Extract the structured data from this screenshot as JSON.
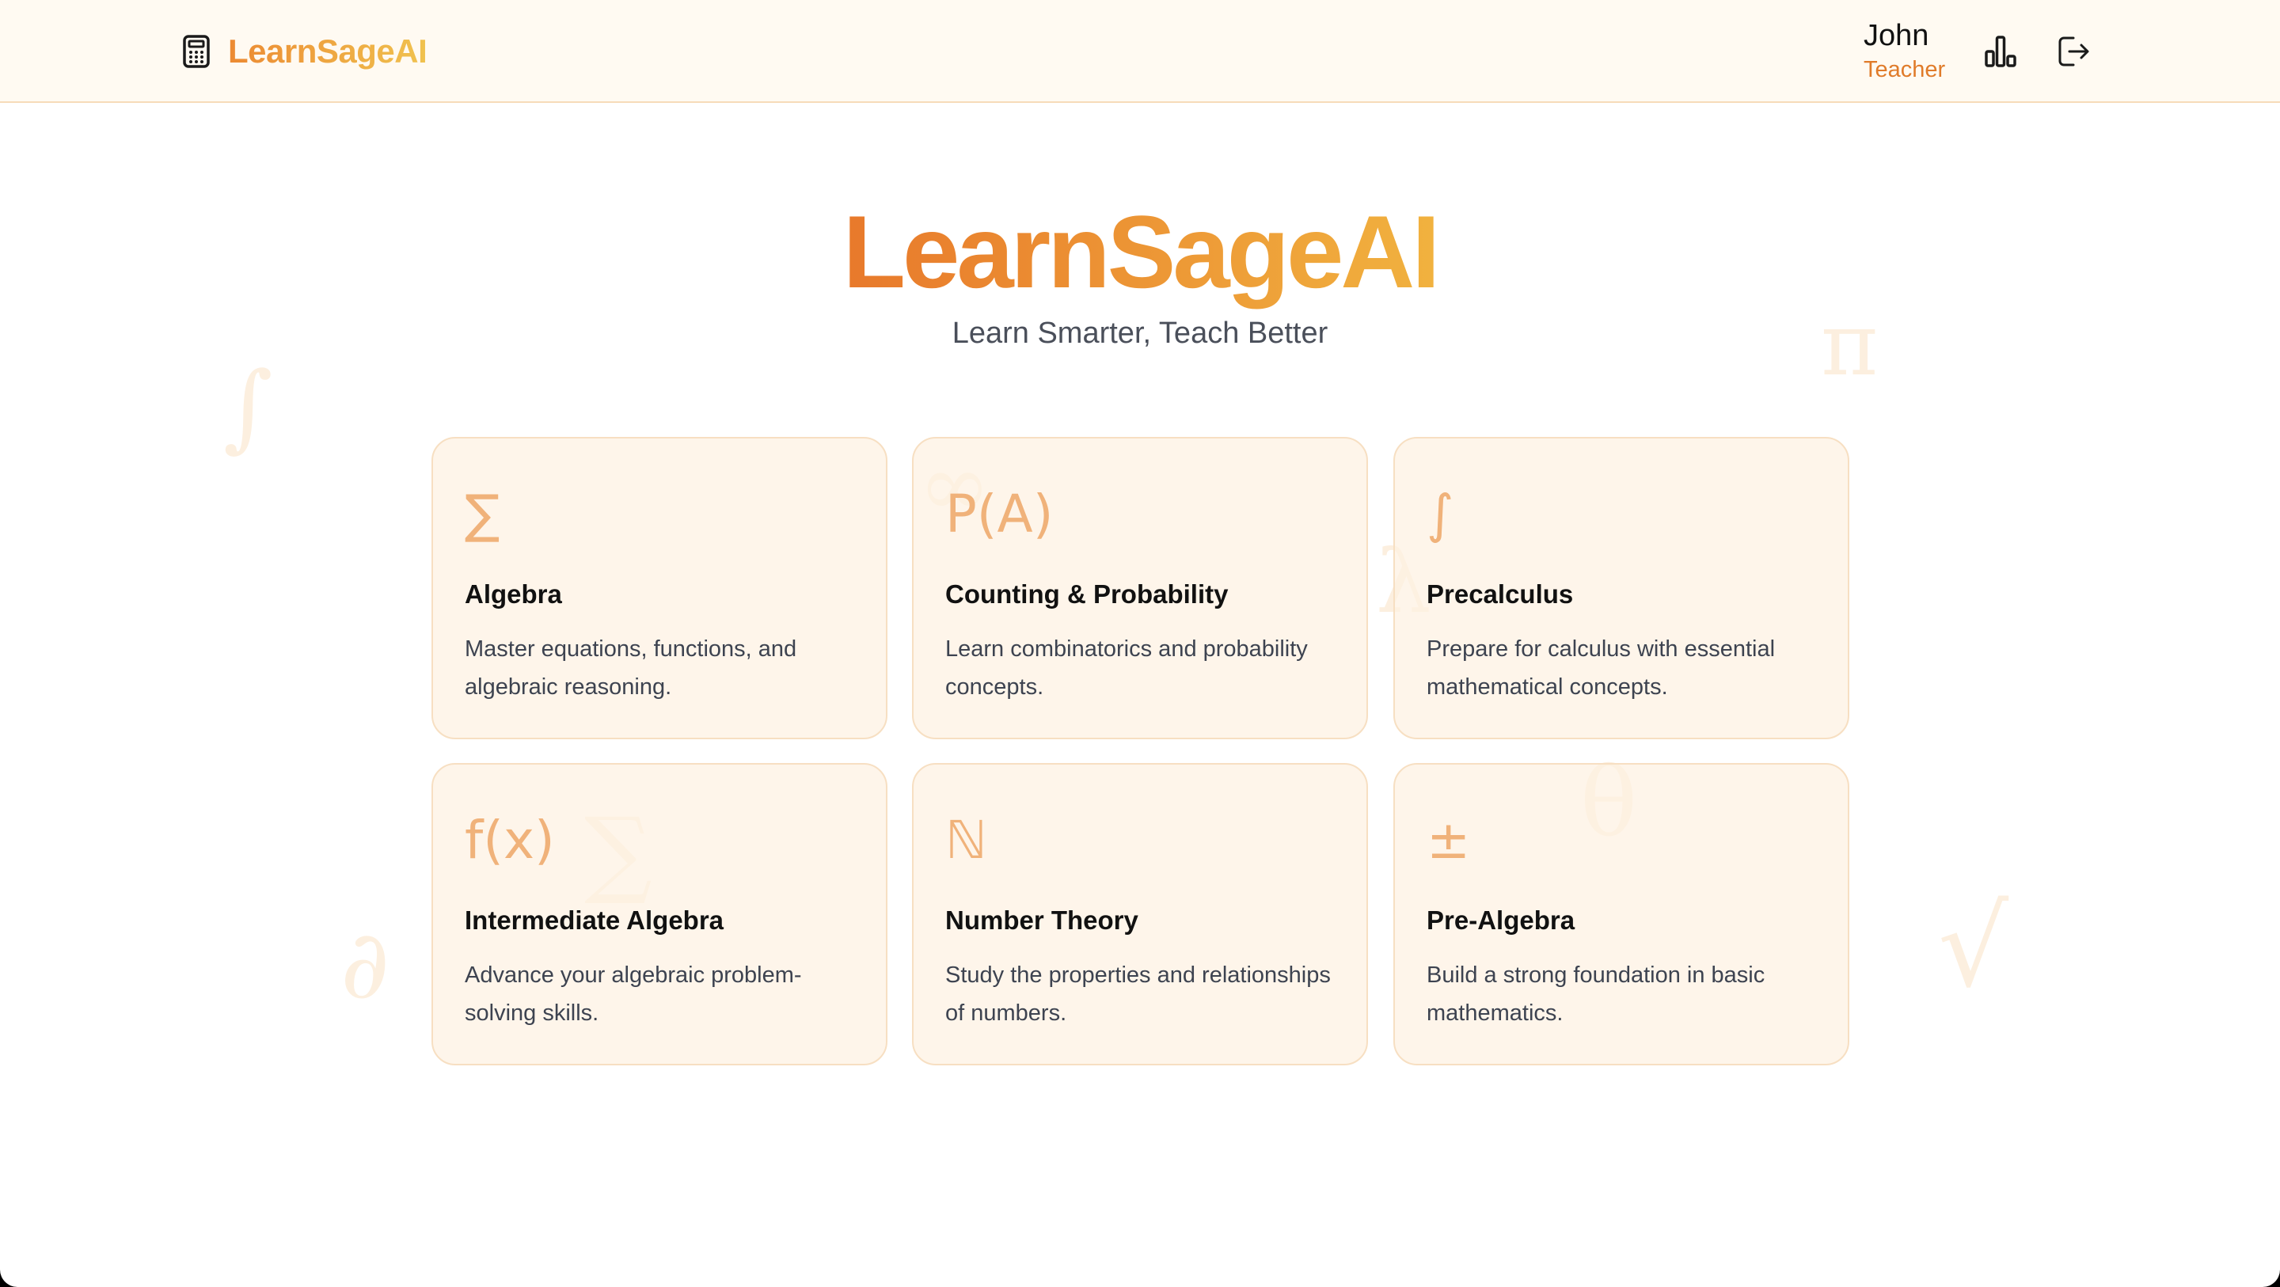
{
  "header": {
    "brand_name": "LearnSageAI",
    "brand_icon": "calculator-icon",
    "user_name": "John",
    "user_role": "Teacher",
    "stats_icon": "bar-chart-icon",
    "logout_icon": "logout-icon"
  },
  "hero": {
    "title": "LearnSageAI",
    "subtitle": "Learn Smarter, Teach Better"
  },
  "background_symbols": [
    "∫",
    "π",
    "∞",
    "λ",
    "∑",
    "θ",
    "∂",
    "√"
  ],
  "courses": [
    {
      "symbol": "∑",
      "title": "Algebra",
      "description": "Master equations, functions, and algebraic reasoning."
    },
    {
      "symbol": "P(A)",
      "title": "Counting & Probability",
      "description": "Learn combinatorics and probability concepts."
    },
    {
      "symbol": "∫",
      "title": "Precalculus",
      "description": "Prepare for calculus with essential mathematical concepts."
    },
    {
      "symbol": "f(x)",
      "title": "Intermediate Algebra",
      "description": "Advance your algebraic problem-solving skills."
    },
    {
      "symbol": "ℕ",
      "title": "Number Theory",
      "description": "Study the properties and relationships of numbers."
    },
    {
      "symbol": "±",
      "title": "Pre-Algebra",
      "description": "Build a strong foundation in basic mathematics."
    }
  ],
  "colors": {
    "accent_start": "#e8792b",
    "accent_end": "#f1b23f",
    "role": "#e07b2a",
    "card_bg": "#fdf1e2",
    "card_border": "#f7dfc2"
  }
}
